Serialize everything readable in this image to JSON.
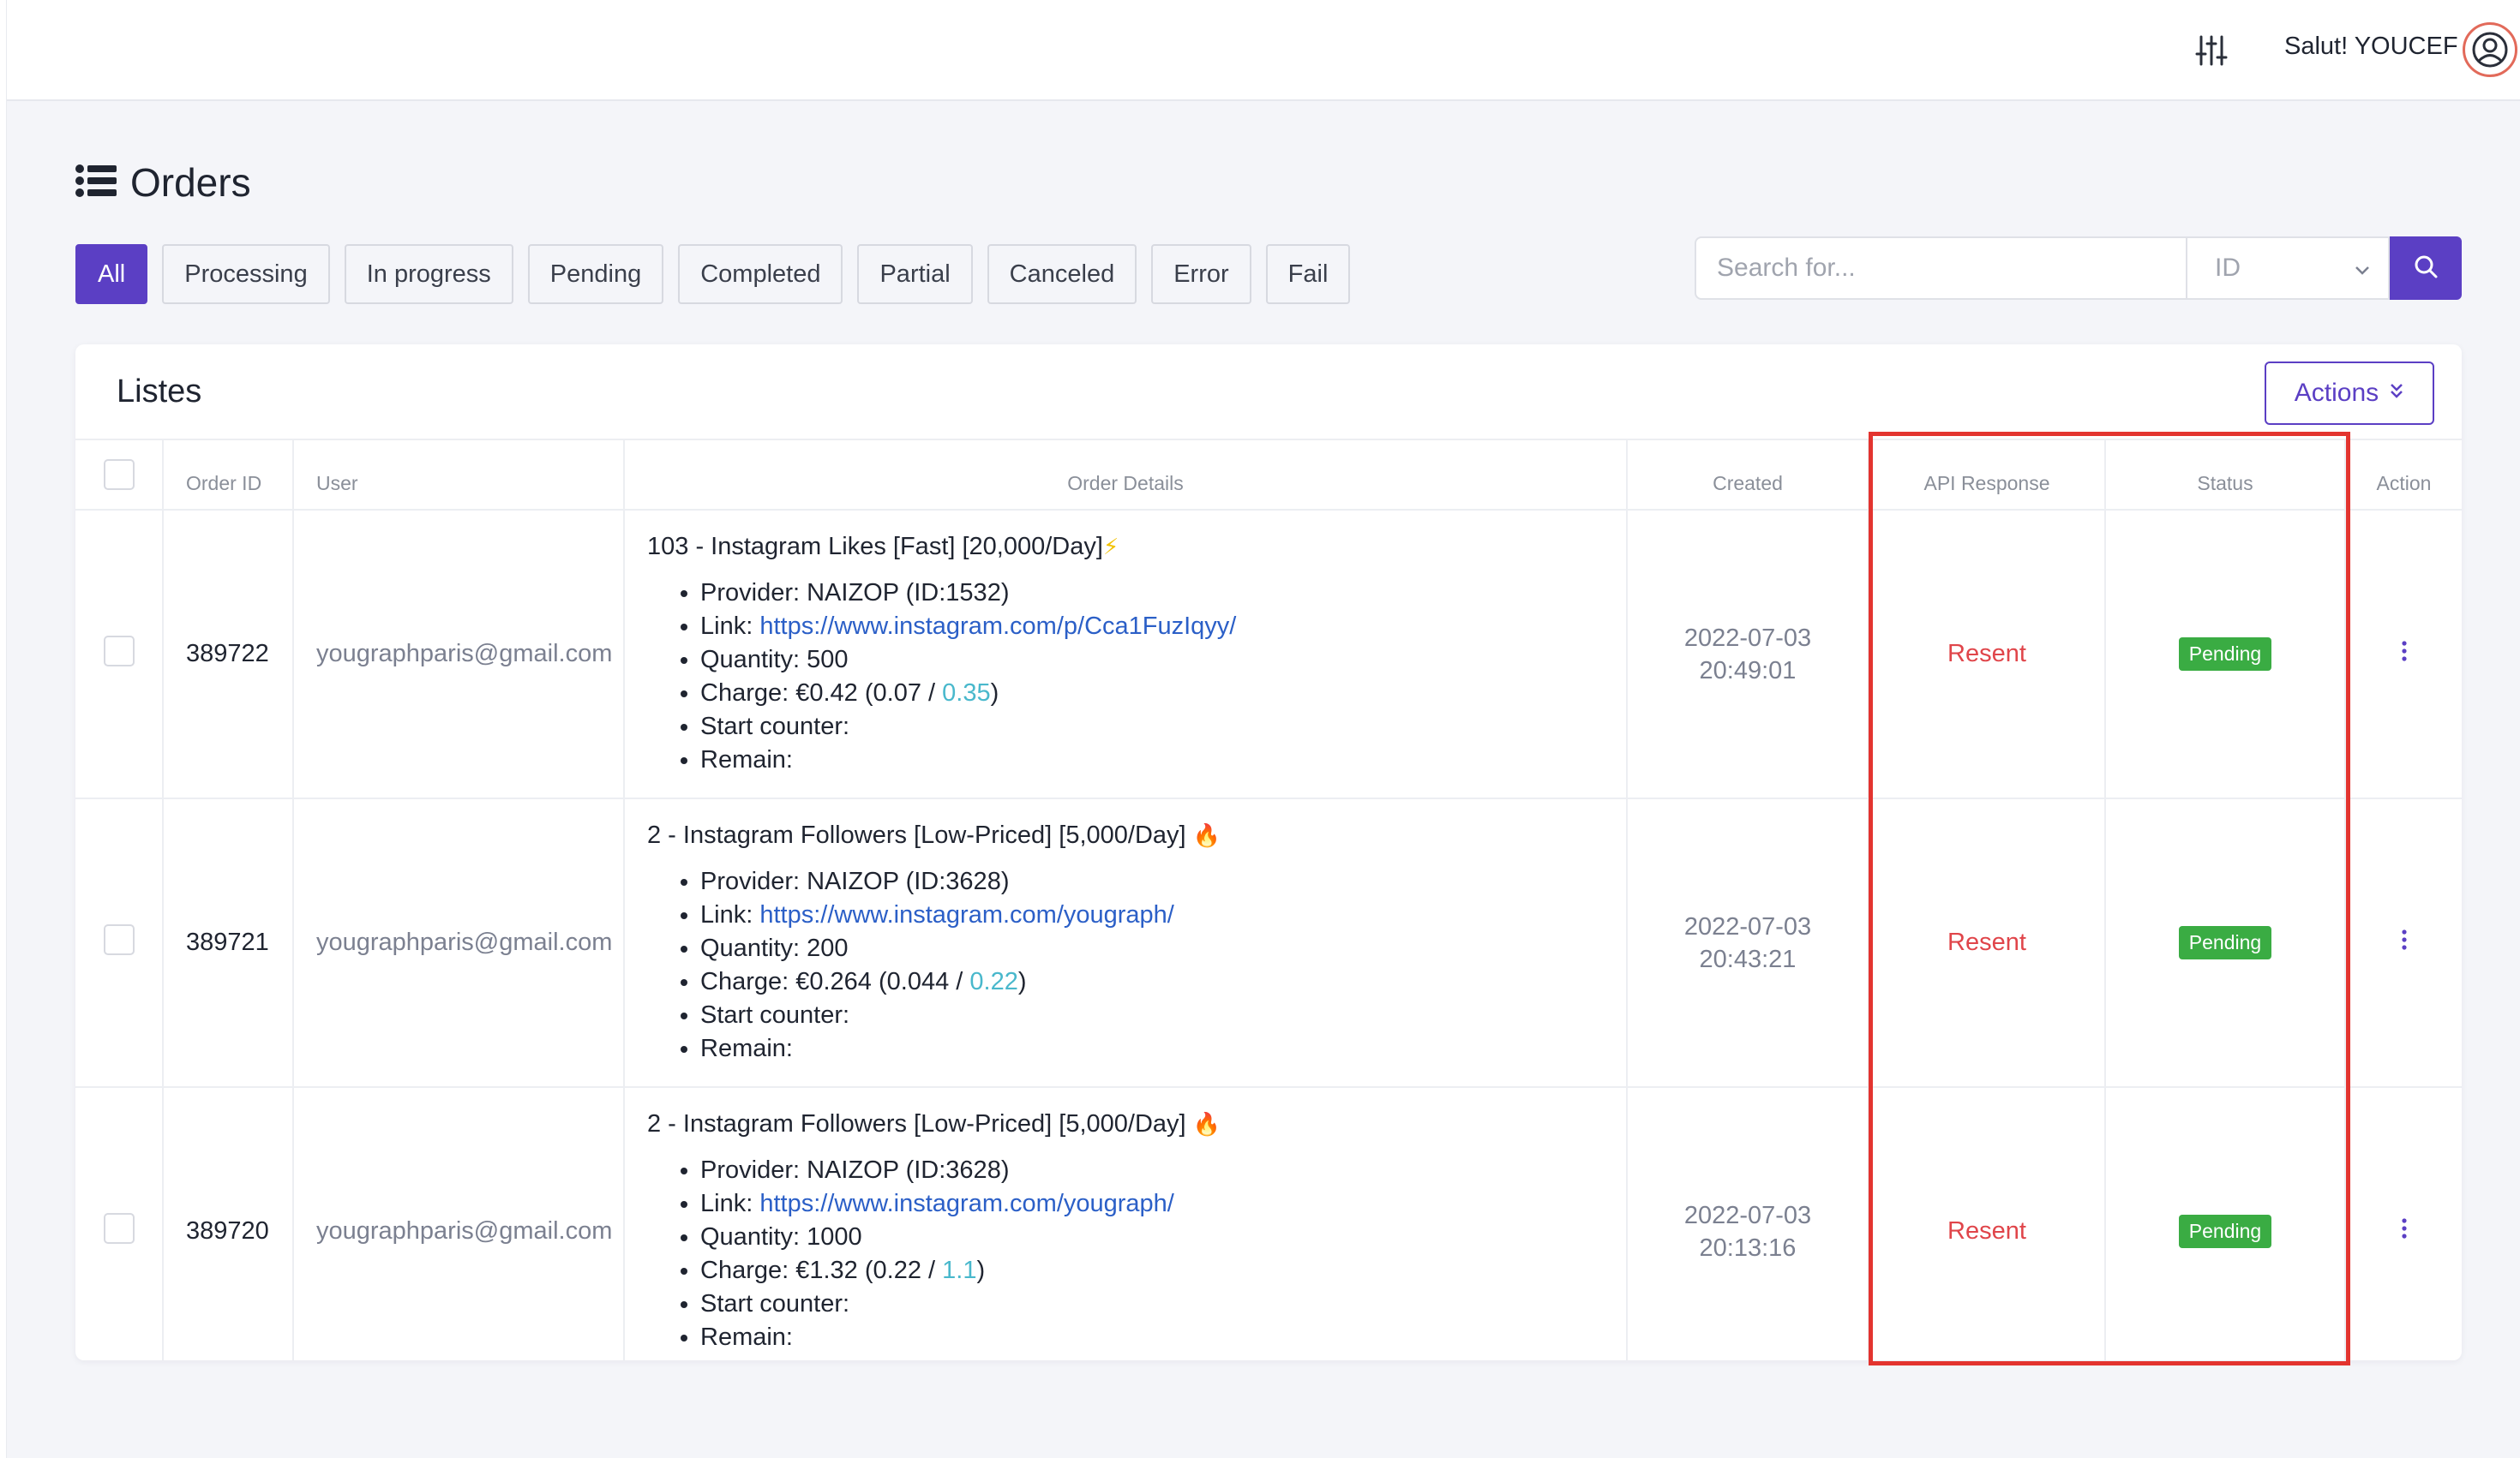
{
  "header": {
    "greeting": "Salut! YOUCEF",
    "filter_icon": "sliders-icon",
    "avatar_icon": "user-circle-icon"
  },
  "page": {
    "title": "Orders",
    "title_icon": "list-icon"
  },
  "filters": [
    "All",
    "Processing",
    "In progress",
    "Pending",
    "Completed",
    "Partial",
    "Canceled",
    "Error",
    "Fail"
  ],
  "search": {
    "placeholder": "Search for...",
    "select_value": "ID",
    "button_icon": "search-icon"
  },
  "card": {
    "title": "Listes",
    "actions_label": "Actions"
  },
  "table": {
    "headers": {
      "order_id": "Order ID",
      "user": "User",
      "details": "Order Details",
      "created": "Created",
      "api": "API Response",
      "status": "Status",
      "action": "Action"
    },
    "rows": [
      {
        "order_id": "389722",
        "user": "yougraphparis@gmail.com",
        "service": "103 - Instagram Likes [Fast] [20,000/Day]",
        "service_emoji": "⚡",
        "provider": "Provider: NAIZOP (ID:1532)",
        "link_label": "Link: ",
        "link": "https://www.instagram.com/p/Cca1FuzIqyy/",
        "quantity": "Quantity: 500",
        "charge_prefix": "Charge: €0.42 (0.07 / ",
        "charge_rate": "0.35",
        "charge_suffix": ")",
        "start_counter": "Start counter:",
        "remain": "Remain:",
        "created_date": "2022-07-03",
        "created_time": "20:49:01",
        "api_response": "Resent",
        "status": "Pending"
      },
      {
        "order_id": "389721",
        "user": "yougraphparis@gmail.com",
        "service": "2 - Instagram Followers [Low-Priced] [5,000/Day]",
        "service_emoji": "🔥",
        "provider": "Provider: NAIZOP (ID:3628)",
        "link_label": "Link: ",
        "link": "https://www.instagram.com/yougraph/",
        "quantity": "Quantity: 200",
        "charge_prefix": "Charge: €0.264 (0.044 / ",
        "charge_rate": "0.22",
        "charge_suffix": ")",
        "start_counter": "Start counter:",
        "remain": "Remain:",
        "created_date": "2022-07-03",
        "created_time": "20:43:21",
        "api_response": "Resent",
        "status": "Pending"
      },
      {
        "order_id": "389720",
        "user": "yougraphparis@gmail.com",
        "service": "2 - Instagram Followers [Low-Priced] [5,000/Day]",
        "service_emoji": "🔥",
        "provider": "Provider: NAIZOP (ID:3628)",
        "link_label": "Link: ",
        "link": "https://www.instagram.com/yougraph/",
        "quantity": "Quantity: 1000",
        "charge_prefix": "Charge: €1.32 (0.22 / ",
        "charge_rate": "1.1",
        "charge_suffix": ")",
        "start_counter": "Start counter:",
        "remain": "Remain:",
        "created_date": "2022-07-03",
        "created_time": "20:13:16",
        "api_response": "Resent",
        "status": "Pending"
      }
    ]
  },
  "colors": {
    "accent": "#5b3fc4",
    "status_pending": "#3aac43",
    "api_resent": "#e0454a",
    "highlight_border": "#e3342f",
    "link": "#2b5fc7",
    "rate": "#49b8cc"
  }
}
